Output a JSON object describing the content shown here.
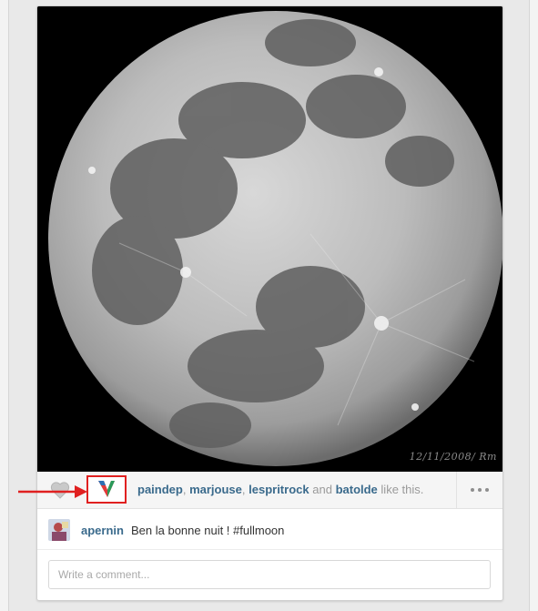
{
  "photo": {
    "stamp": "12/11/2008/ Rm"
  },
  "likes": {
    "likers": [
      "paindep",
      "marjouse",
      "lespritrock"
    ],
    "and_word": "and",
    "last_liker": "batolde",
    "suffix": "like this."
  },
  "caption": {
    "username": "apernin",
    "text": "Ben la bonne nuit ! #fullmoon"
  },
  "comment": {
    "placeholder": "Write a comment..."
  },
  "colors": {
    "link": "#3a6a8c",
    "annotation": "#e02020"
  },
  "icons": {
    "like": "heart-icon",
    "more": "more-options-icon",
    "annotation": "red-arrow"
  }
}
